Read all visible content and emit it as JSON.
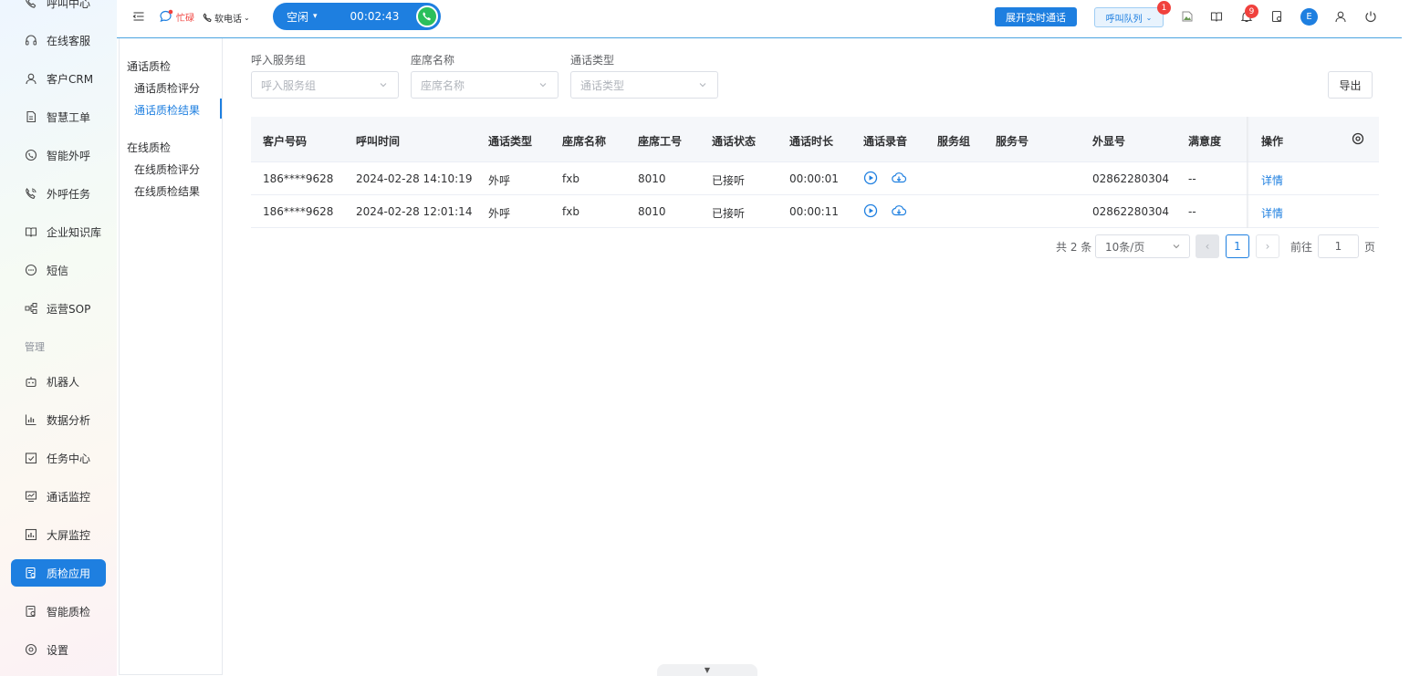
{
  "sidebar": {
    "items": [
      {
        "label": "呼叫中心",
        "icon": "phone-icon"
      },
      {
        "label": "在线客服",
        "icon": "headset-icon"
      },
      {
        "label": "客户CRM",
        "icon": "user-icon"
      },
      {
        "label": "智慧工单",
        "icon": "document-icon"
      },
      {
        "label": "智能外呼",
        "icon": "whatsapp-icon"
      },
      {
        "label": "外呼任务",
        "icon": "phone-wave-icon"
      },
      {
        "label": "企业知识库",
        "icon": "book-icon"
      },
      {
        "label": "短信",
        "icon": "message-icon"
      },
      {
        "label": "运营SOP",
        "icon": "flow-icon"
      },
      {
        "label": "机器人",
        "icon": "robot-icon"
      },
      {
        "label": "数据分析",
        "icon": "bar-chart-icon"
      },
      {
        "label": "任务中心",
        "icon": "checklist-icon"
      },
      {
        "label": "通话监控",
        "icon": "monitor-icon"
      },
      {
        "label": "大屏监控",
        "icon": "dashboard-icon"
      },
      {
        "label": "质检应用",
        "icon": "inspect-icon",
        "active": true
      },
      {
        "label": "智能质检",
        "icon": "inspect-smart-icon"
      },
      {
        "label": "设置",
        "icon": "settings-icon"
      }
    ],
    "section_label": "管理"
  },
  "subnav": {
    "group1": "通话质检",
    "group1_items": [
      "通话质检评分",
      "通话质检结果"
    ],
    "group2": "在线质检",
    "group2_items": [
      "在线质检评分",
      "在线质检结果"
    ]
  },
  "topbar": {
    "busy_label": "忙碌",
    "softphone_label": "软电话",
    "status_label": "空闲",
    "timer": "00:02:43",
    "realtime_button": "展开实时通话",
    "queue_button": "呼叫队列",
    "queue_badge": "1",
    "notify_badge": "9",
    "avatar_initial": "E"
  },
  "filters": {
    "group_label": "呼入服务组",
    "group_placeholder": "呼入服务组",
    "agent_label": "座席名称",
    "agent_placeholder": "座席名称",
    "type_label": "通话类型",
    "type_placeholder": "通话类型",
    "export_button": "导出"
  },
  "table": {
    "headers": [
      "客户号码",
      "呼叫时间",
      "通话类型",
      "座席名称",
      "座席工号",
      "通话状态",
      "通话时长",
      "通话录音",
      "服务组",
      "服务号",
      "外显号",
      "满意度",
      "操作"
    ],
    "rows": [
      {
        "customer": "186****9628",
        "time": "2024-02-28 14:10:19",
        "type": "外呼",
        "agent": "fxb",
        "agent_id": "8010",
        "status": "已接听",
        "duration": "00:00:01",
        "group": "",
        "service_no": "",
        "display_no": "02862280304",
        "satisfaction": "--",
        "action": "详情"
      },
      {
        "customer": "186****9628",
        "time": "2024-02-28 12:01:14",
        "type": "外呼",
        "agent": "fxb",
        "agent_id": "8010",
        "status": "已接听",
        "duration": "00:00:11",
        "group": "",
        "service_no": "",
        "display_no": "02862280304",
        "satisfaction": "--",
        "action": "详情"
      }
    ]
  },
  "pagination": {
    "total": "共 2 条",
    "page_size": "10条/页",
    "current": "1",
    "goto_label": "前往",
    "goto_value": "1",
    "page_suffix": "页"
  },
  "colors": {
    "accent": "#1e7fe0",
    "call_green": "#2bbf5c",
    "badge_red": "#f0413d"
  }
}
